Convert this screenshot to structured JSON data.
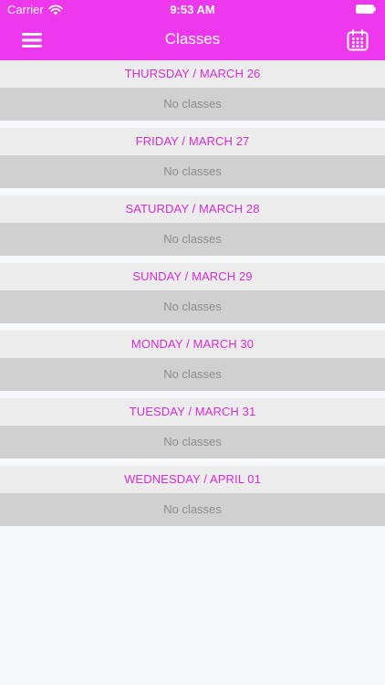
{
  "status_bar": {
    "carrier": "Carrier",
    "time": "9:53 AM"
  },
  "nav": {
    "title": "Classes",
    "left_icon": "hamburger-menu-icon",
    "right_icon": "calendar-icon"
  },
  "colors": {
    "brand": "#ec37ec",
    "day_header_text": "#d42ed4",
    "day_header_bg": "#ececec",
    "day_body_bg": "#d0d0d0",
    "empty_text": "#8c8c8c"
  },
  "days": [
    {
      "header": "THURSDAY / MARCH 26",
      "body": "No classes"
    },
    {
      "header": "FRIDAY / MARCH 27",
      "body": "No classes"
    },
    {
      "header": "SATURDAY / MARCH 28",
      "body": "No classes"
    },
    {
      "header": "SUNDAY / MARCH 29",
      "body": "No classes"
    },
    {
      "header": "MONDAY / MARCH 30",
      "body": "No classes"
    },
    {
      "header": "TUESDAY / MARCH 31",
      "body": "No classes"
    },
    {
      "header": "WEDNESDAY / APRIL 01",
      "body": "No classes"
    }
  ]
}
